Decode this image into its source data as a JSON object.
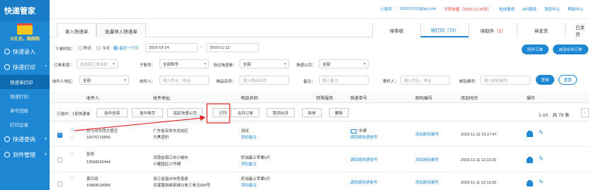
{
  "sidebar": {
    "title": "快递管家",
    "promo": "大礼包，购限购",
    "items": [
      {
        "label": "快递录入",
        "sub": []
      },
      {
        "label": "快递打印",
        "sub": [
          "快递单打印",
          "快递打印",
          "单号回收",
          "打印记录"
        ]
      },
      {
        "label": "快递查询",
        "sub": []
      },
      {
        "label": "到件管理",
        "sub": []
      }
    ]
  },
  "topbar": {
    "links": [
      "小程序",
      "506031763@qq.com",
      "不限单量（2023-12-25到）",
      "短信服务",
      "API服务",
      "消息中心",
      "帮助中心"
    ]
  },
  "left_tabs": [
    "录入快递单",
    "批量导入快递单"
  ],
  "right_tabs": [
    {
      "label": "待审核",
      "count": ""
    },
    {
      "label": "待打印",
      "count": "（79）"
    },
    {
      "label": "待取件",
      "count": "（1）"
    },
    {
      "label": "待发货",
      "count": ""
    },
    {
      "label": "已发货",
      "count": ""
    }
  ],
  "filters": {
    "order_time_label": "下单时间：",
    "radios": [
      "昨天",
      "今天",
      "最近一个月"
    ],
    "date_from": "2019-10-14",
    "date_to": "2019-11-13",
    "btn_sync": "同步订单",
    "btn_auto": "自动合并订单",
    "order_source_label": "订单来源：",
    "order_source_ph": "请选择订单来源",
    "sub_account_label": "子账号：",
    "sub_account_val": "全部账号",
    "protocol_label": "协议快递单：",
    "protocol_val": "全部",
    "company_label": "快递公司：",
    "company_val": "全部",
    "region_label": "收件人地区：",
    "region_val": "全部",
    "receiver_label": "收件人：",
    "receiver_ph": "输入姓名、电话",
    "item_label": "物品名称：",
    "item_ph": "输入物品名称",
    "remark_label": "备注：",
    "remark_ph": "输入备注",
    "sender_label": "寄件人：",
    "sender_ph": "输入姓名、电话",
    "postcode_label": "邮码编号：",
    "postcode_ph": "输入邮码编号",
    "btn_search": "查询",
    "btn_reset": "重置"
  },
  "table": {
    "headers": [
      "收件人",
      "收件地址",
      "物品名称",
      "特殊服务",
      "快递单号",
      "邮码编号",
      "添加时间",
      "操作"
    ],
    "selected_text": "已选中：1张快递单",
    "actions": [
      "选中全部",
      "选中单页",
      "指定快递公司",
      "打印",
      "合并订单",
      "取消合并",
      "拆单",
      "删除"
    ],
    "pagination": "1-10　共 79 条",
    "rows": [
      {
        "name": "抓马沟东西大督空",
        "phone": "18376719855",
        "addr1": "广东省深圳市龙岗区",
        "addr2": "大黑道的",
        "item": "测试",
        "item_link": "添加备注",
        "service": "",
        "carrier": "中通",
        "tracking": "请回填快递单号",
        "postcode": "添加邮码编号",
        "time": "2019-11-12 15:17:47",
        "checked": true
      },
      {
        "name": "张青",
        "phone": "13598329444",
        "addr1": "河南省周口市小城市",
        "addr2": "小暖园区27号楼",
        "item": "奶油蛋士苹果5斤",
        "item_link": "添加备注",
        "service": "",
        "carrier": "",
        "tracking": "请回填快递单号",
        "postcode": "添加邮码编号",
        "time": "2019-11-11 12:13:32",
        "checked": false
      },
      {
        "name": "黄日培",
        "phone": "15868018089",
        "addr1": "浙江省温州市苍南县",
        "addr2": "灵溪镇浙闽商城11栋三单元606号",
        "item": "奶油蛋士苹果5斤",
        "item_link": "添加备注",
        "service": "",
        "carrier": "",
        "tracking": "请回填快递单号",
        "postcode": "添加邮码编号",
        "time": "2019-11-11 12:13:32",
        "checked": false
      }
    ]
  },
  "colors": {
    "primary": "#1d87d4",
    "annotation": "#e02020"
  }
}
